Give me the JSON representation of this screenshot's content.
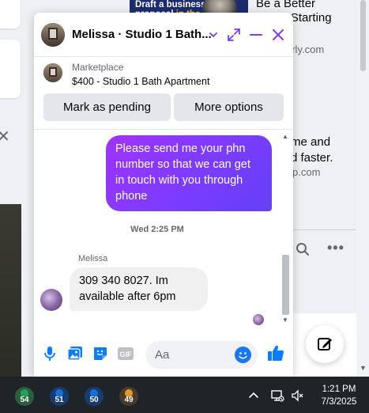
{
  "background": {
    "ad_line1": "Draft a business",
    "ad_line2a": "proposal ",
    "ad_line2b": "in the",
    "side_text1": "Be a Better",
    "side_text2": "Writer Starting",
    "side_sub1": "arly.com",
    "side_text3": "me and",
    "side_text4": "d faster.",
    "side_sub2": "p.com"
  },
  "chat": {
    "title": "Melissa · Studio 1 Bath...",
    "marketplace_label": "Marketplace",
    "listing": "$400 - Studio 1 Bath Apartment",
    "buttons": {
      "pending": "Mark as pending",
      "more": "More options"
    },
    "messages": [
      {
        "from": "me",
        "text": "Please send me your phn number so that we can get in touch with you through phone"
      },
      {
        "from": "Melissa",
        "text": "309 340 8027. Im available after 6pm"
      }
    ],
    "timestamp": "Wed 2:25 PM",
    "sender_name": "Melissa",
    "input_placeholder": "Aa"
  },
  "taskbar": {
    "apps": [
      {
        "badge": "54",
        "color": "#1fa35a"
      },
      {
        "badge": "51",
        "color": "#1a6fd6"
      },
      {
        "badge": "50",
        "color": "#1a6fd6"
      },
      {
        "badge": "49",
        "color": "#e09a2b"
      }
    ],
    "time": "1:21 PM",
    "date": "7/3/2025"
  },
  "colors": {
    "messenger_blue": "#0a7cff",
    "outgoing_bubble": "#8a3cff",
    "incoming_bubble": "#f0f0f0",
    "taskbar": "#1f2428"
  }
}
